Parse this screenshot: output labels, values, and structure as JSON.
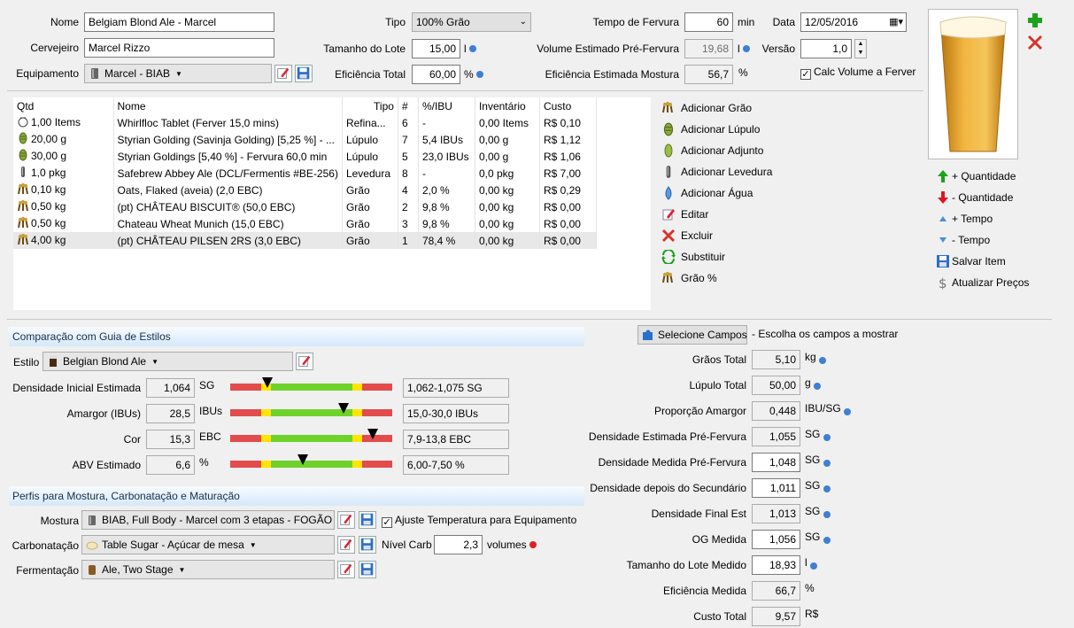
{
  "header": {
    "nome_label": "Nome",
    "nome_value": "Belgiam Blond Ale - Marcel",
    "cervejeiro_label": "Cervejeiro",
    "cervejeiro_value": "Marcel Rizzo",
    "equipamento_label": "Equipamento",
    "equipamento_value": "Marcel - BIAB",
    "tipo_label": "Tipo",
    "tipo_value": "100% Grão",
    "tamanho_label": "Tamanho do Lote",
    "tamanho_value": "15,00",
    "tamanho_unit": "l",
    "eficiencia_label": "Eficiência Total",
    "eficiencia_value": "60,00",
    "eficiencia_unit": "%",
    "fervura_label": "Tempo de Fervura",
    "fervura_value": "60",
    "fervura_unit": "min",
    "volume_label": "Volume Estimado Pré-Fervura",
    "volume_value": "19,68",
    "volume_unit": "l",
    "efmostura_label": "Eficiência Estimada Mostura",
    "efmostura_value": "56,7",
    "efmostura_unit": "%",
    "data_label": "Data",
    "data_value": "12/05/2016",
    "versao_label": "Versão",
    "versao_value": "1,0",
    "calc_label": "Calc Volume a Ferver",
    "calc_checked": "✓"
  },
  "ingredients": {
    "columns": [
      "Qtd",
      "Nome",
      "Tipo",
      "#",
      "%/IBU",
      "Inventário",
      "Custo"
    ],
    "rows": [
      {
        "icon": "misc-icon",
        "qtd": "1,00 Items",
        "nome": "Whirlfloc Tablet (Ferver 15,0 mins)",
        "tipo": "Refina...",
        "num": "6",
        "pct": "-",
        "inv": "0,00 Items",
        "custo": "R$ 0,10"
      },
      {
        "icon": "hop-icon",
        "qtd": "20,00 g",
        "nome": "Styrian Golding (Savinja Golding) [5,25 %] - ...",
        "tipo": "Lúpulo",
        "num": "7",
        "pct": "5,4 IBUs",
        "inv": "0,00 g",
        "custo": "R$ 1,12"
      },
      {
        "icon": "hop-icon",
        "qtd": "30,00 g",
        "nome": "Styrian Goldings [5,40 %] - Fervura 60,0 min",
        "tipo": "Lúpulo",
        "num": "5",
        "pct": "23,0 IBUs",
        "inv": "0,00 g",
        "custo": "R$ 1,06"
      },
      {
        "icon": "yeast-icon",
        "qtd": "1,0 pkg",
        "nome": "Safebrew Abbey Ale (DCL/Fermentis #BE-256)",
        "tipo": "Levedura",
        "num": "8",
        "pct": "-",
        "inv": "0,0 pkg",
        "custo": "R$ 7,00"
      },
      {
        "icon": "grain-icon",
        "qtd": "0,10 kg",
        "nome": "Oats, Flaked (aveia) (2,0 EBC)",
        "tipo": "Grão",
        "num": "4",
        "pct": "2,0 %",
        "inv": "0,00 kg",
        "custo": "R$ 0,29"
      },
      {
        "icon": "grain-icon",
        "qtd": "0,50 kg",
        "nome": "(pt) CHÂTEAU BISCUIT® (50,0 EBC)",
        "tipo": "Grão",
        "num": "2",
        "pct": "9,8 %",
        "inv": "0,00 kg",
        "custo": "R$ 0,00"
      },
      {
        "icon": "grain-icon",
        "qtd": "0,50 kg",
        "nome": "Chateau Wheat Munich (15,0 EBC)",
        "tipo": "Grão",
        "num": "3",
        "pct": "9,8 %",
        "inv": "0,00 kg",
        "custo": "R$ 0,00"
      },
      {
        "icon": "grain-icon",
        "qtd": "4,00 kg",
        "nome": "(pt) CHÂTEAU PILSEN 2RS (3,0 EBC)",
        "tipo": "Grão",
        "num": "1",
        "pct": "78,4 %",
        "inv": "0,00 kg",
        "custo": "R$ 0,00"
      }
    ]
  },
  "actions": [
    "Adicionar Grão",
    "Adicionar Lúpulo",
    "Adicionar Adjunto",
    "Adicionar Levedura",
    "Adicionar Água",
    "Editar",
    "Excluir",
    "Substituir",
    "Grão %"
  ],
  "side_actions": [
    "+ Quantidade",
    "- Quantidade",
    "+ Tempo",
    "- Tempo",
    "Salvar Item",
    "Atualizar Preços"
  ],
  "style": {
    "section_title": "Comparação com Guia de Estilos",
    "estilo_label": "Estilo",
    "estilo_value": "Belgian Blond Ale",
    "rows": [
      {
        "label": "Densidade Inicial Estimada",
        "value": "1,064",
        "unit": "SG",
        "range": "1,062-1,075 SG",
        "marker": 0.23
      },
      {
        "label": "Amargor (IBUs)",
        "value": "28,5",
        "unit": "IBUs",
        "range": "15,0-30,0 IBUs",
        "marker": 0.7
      },
      {
        "label": "Cor",
        "value": "15,3",
        "unit": "EBC",
        "range": "7,9-13,8 EBC",
        "marker": 0.88
      },
      {
        "label": "ABV Estimado",
        "value": "6,6",
        "unit": "%",
        "range": "6,00-7,50 %",
        "marker": 0.45
      }
    ]
  },
  "profiles": {
    "section_title": "Perfis para Mostura, Carbonatação e Maturação",
    "mostura_label": "Mostura",
    "mostura_value": "BIAB, Full Body - Marcel com 3 etapas - FOGÃO",
    "ajuste_label": "Ajuste Temperatura para Equipamento",
    "ajuste_checked": "✓",
    "carb_label": "Carbonatação",
    "carb_value": "Table Sugar - Açúcar de mesa",
    "nivel_label": "Nível Carb",
    "nivel_value": "2,3",
    "nivel_unit": "volumes",
    "ferm_label": "Fermentação",
    "ferm_value": "Ale, Two Stage"
  },
  "stats": {
    "selecione_label": "Selecione Campos",
    "selecione_hint": "- Escolha os campos a mostrar",
    "rows": [
      {
        "label": "Grãos Total",
        "value": "5,10",
        "unit": "kg",
        "dot": true,
        "edit": false
      },
      {
        "label": "Lúpulo Total",
        "value": "50,00",
        "unit": "g",
        "dot": true,
        "edit": false
      },
      {
        "label": "Proporção Amargor",
        "value": "0,448",
        "unit": "IBU/SG",
        "dot": true,
        "edit": false
      },
      {
        "label": "Densidade Estimada Pré-Fervura",
        "value": "1,055",
        "unit": "SG",
        "dot": true,
        "edit": false
      },
      {
        "label": "Densidade Medida Pré-Fervura",
        "value": "1,048",
        "unit": "SG",
        "dot": true,
        "edit": true
      },
      {
        "label": "Densidade depois do Secundário",
        "value": "1,011",
        "unit": "SG",
        "dot": true,
        "edit": true
      },
      {
        "label": "Densidade Final Est",
        "value": "1,013",
        "unit": "SG",
        "dot": true,
        "edit": false
      },
      {
        "label": "OG Medida",
        "value": "1,056",
        "unit": "SG",
        "dot": true,
        "edit": true
      },
      {
        "label": "Tamanho do Lote Medido",
        "value": "18,93",
        "unit": "l",
        "dot": true,
        "edit": true
      },
      {
        "label": "Eficiência Medida",
        "value": "66,7",
        "unit": "%",
        "dot": false,
        "edit": false
      },
      {
        "label": "Custo Total",
        "value": "9,57",
        "unit": "R$",
        "dot": false,
        "edit": false
      }
    ]
  },
  "colors": {
    "accent": "#3f7fd4",
    "bar_red": "#e24c4c",
    "bar_green": "#6ed22a",
    "bar_yellow": "#ffe500"
  }
}
